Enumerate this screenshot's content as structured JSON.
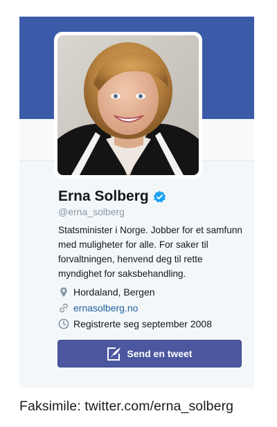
{
  "profile": {
    "name": "Erna Solberg",
    "handle": "@erna_solberg",
    "bio": "Statsminister i Norge. Jobber for et samfunn med muligheter for alle. For saker til forvaltningen, henvend deg til rette myndighet for saksbehandling.",
    "location": "Hordaland, Bergen",
    "website": "ernasolberg.no",
    "joined": "Registrerte seg september 2008",
    "verified": true
  },
  "actions": {
    "tweet_label": "Send en tweet"
  },
  "icons": {
    "verified": "verified-badge-icon",
    "location": "location-pin-icon",
    "link": "link-icon",
    "calendar": "clock-icon",
    "tweet": "compose-tweet-icon"
  },
  "colors": {
    "banner": "#3b5ba9",
    "verified": "#1da1f2",
    "link": "#1b5f9e",
    "button": "#4b579f"
  },
  "caption": "Faksimile: twitter.com/erna_solberg"
}
